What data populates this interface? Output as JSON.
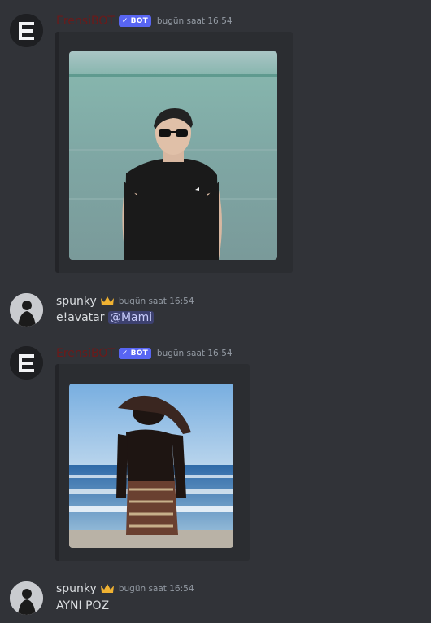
{
  "messages": [
    {
      "author": "ErensiBOT",
      "bot_badge": "BOT",
      "timestamp": "bugün saat 16:54",
      "embed_image": "avatar-image-man-sunglasses-beach"
    },
    {
      "author": "spunky",
      "timestamp": "bugün saat 16:54",
      "text": "e!avatar",
      "mention": "@Mami"
    },
    {
      "author": "ErensiBOT",
      "bot_badge": "BOT",
      "timestamp": "bugün saat 16:54",
      "embed_image": "avatar-image-man-beach-ocean"
    },
    {
      "author": "spunky",
      "timestamp": "bugün saat 16:54",
      "text": "AYNI POZ"
    }
  ],
  "colors": {
    "background": "#313338",
    "embed": "#2b2d31",
    "bot_badge": "#5865f2",
    "bot_name": "#6b1a1a",
    "user_name": "#dbdee1",
    "timestamp": "#949ba4",
    "mention_bg": "#3c4270"
  }
}
